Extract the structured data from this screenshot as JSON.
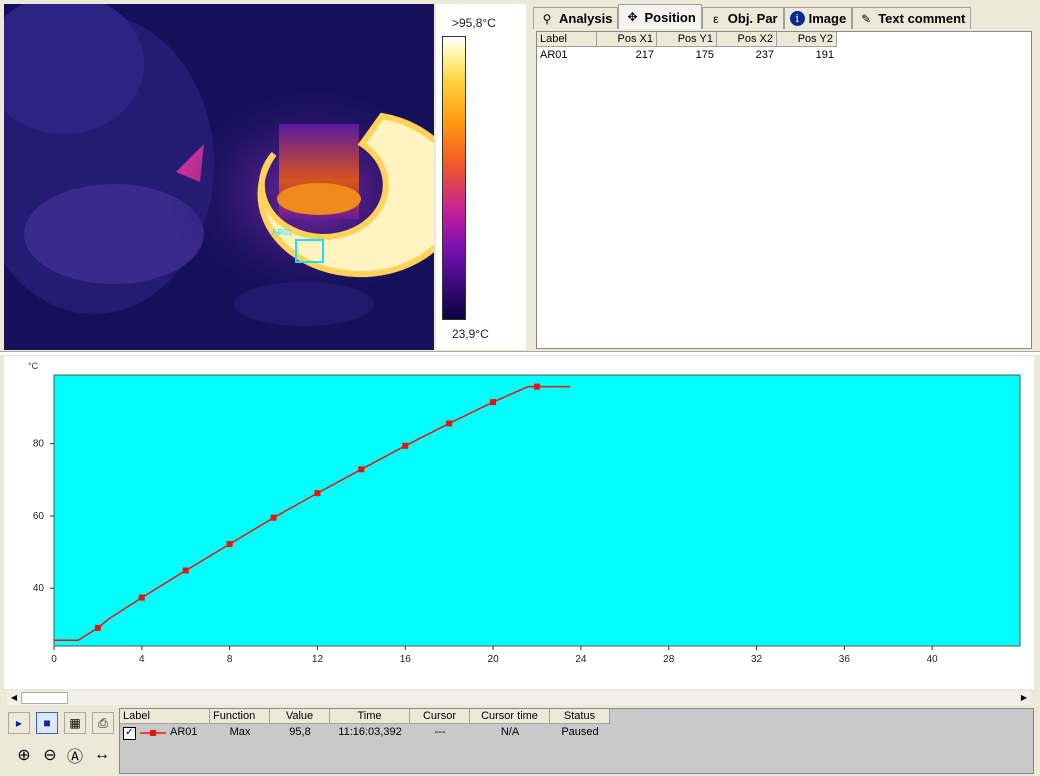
{
  "image": {
    "max_temp_label": ">95,8°C",
    "min_temp_label": "23,9°C",
    "roi_label": "AR01",
    "roi_color": "#18e0ff"
  },
  "tabs": [
    {
      "label": "Analysis",
      "icon": "analysis-icon",
      "active": false
    },
    {
      "label": "Position",
      "icon": "position-icon",
      "active": true
    },
    {
      "label": "Obj. Par",
      "icon": "object-parameters-icon",
      "active": false
    },
    {
      "label": "Image",
      "icon": "info-icon",
      "active": false
    },
    {
      "label": "Text comment",
      "icon": "text-comment-icon",
      "active": false
    }
  ],
  "position_table": {
    "columns": [
      "Label",
      "Pos X1",
      "Pos Y1",
      "Pos X2",
      "Pos Y2"
    ],
    "rows": [
      [
        "AR01",
        "217",
        "175",
        "237",
        "191"
      ]
    ]
  },
  "chart_data": {
    "type": "line",
    "ylabel": "°C",
    "xlabel": "",
    "xlim": [
      0,
      44
    ],
    "ylim": [
      24,
      99
    ],
    "x_ticks": [
      0,
      4,
      8,
      12,
      16,
      20,
      24,
      28,
      32,
      36,
      40
    ],
    "y_ticks": [
      40,
      60,
      80
    ],
    "background": "#00ffff",
    "line_color": "#e8140c",
    "series": [
      {
        "name": "AR01",
        "x": [
          0,
          1.1,
          2.0,
          2.5,
          4.0,
          6.0,
          8.0,
          10.0,
          12.0,
          14.0,
          16.0,
          18.0,
          20.0,
          21.6,
          23.5
        ],
        "y": [
          25.6,
          25.6,
          29.0,
          31.5,
          37.4,
          44.9,
          52.2,
          59.5,
          66.3,
          72.9,
          79.4,
          85.6,
          91.5,
          95.8,
          95.8
        ],
        "markers_x": [
          2.0,
          4.0,
          6.0,
          8.0,
          10.0,
          12.0,
          14.0,
          16.0,
          18.0,
          20.0,
          22.0
        ],
        "markers_y": [
          29.0,
          37.4,
          44.9,
          52.2,
          59.5,
          66.3,
          72.9,
          79.4,
          85.6,
          91.5,
          95.8
        ]
      }
    ]
  },
  "toolbar": [
    {
      "icon": "play-icon",
      "glyph": "▶",
      "pressed": false
    },
    {
      "icon": "stop-icon",
      "glyph": "■",
      "pressed": true
    },
    {
      "icon": "chart-settings-icon",
      "glyph": "▦",
      "pressed": false
    },
    {
      "icon": "export-icon",
      "glyph": "⎙",
      "pressed": false
    },
    {
      "icon": "zoom-in-icon",
      "glyph": "⊕",
      "pressed": false
    },
    {
      "icon": "zoom-out-icon",
      "glyph": "⊖",
      "pressed": false
    },
    {
      "icon": "zoom-auto-icon",
      "glyph": "Ⓐ",
      "pressed": false
    },
    {
      "icon": "fit-width-icon",
      "glyph": "↔",
      "pressed": false
    }
  ],
  "legend_table": {
    "columns": [
      "Label",
      "Function",
      "Value",
      "Time",
      "Cursor",
      "Cursor time",
      "Status"
    ],
    "rows": [
      {
        "checked": true,
        "check_mark": "✓",
        "label": "AR01",
        "function": "Max",
        "value": "95,8",
        "time": "11:16:03,392",
        "cursor": "---",
        "cursor_time": "N/A",
        "status": "Paused"
      }
    ]
  }
}
